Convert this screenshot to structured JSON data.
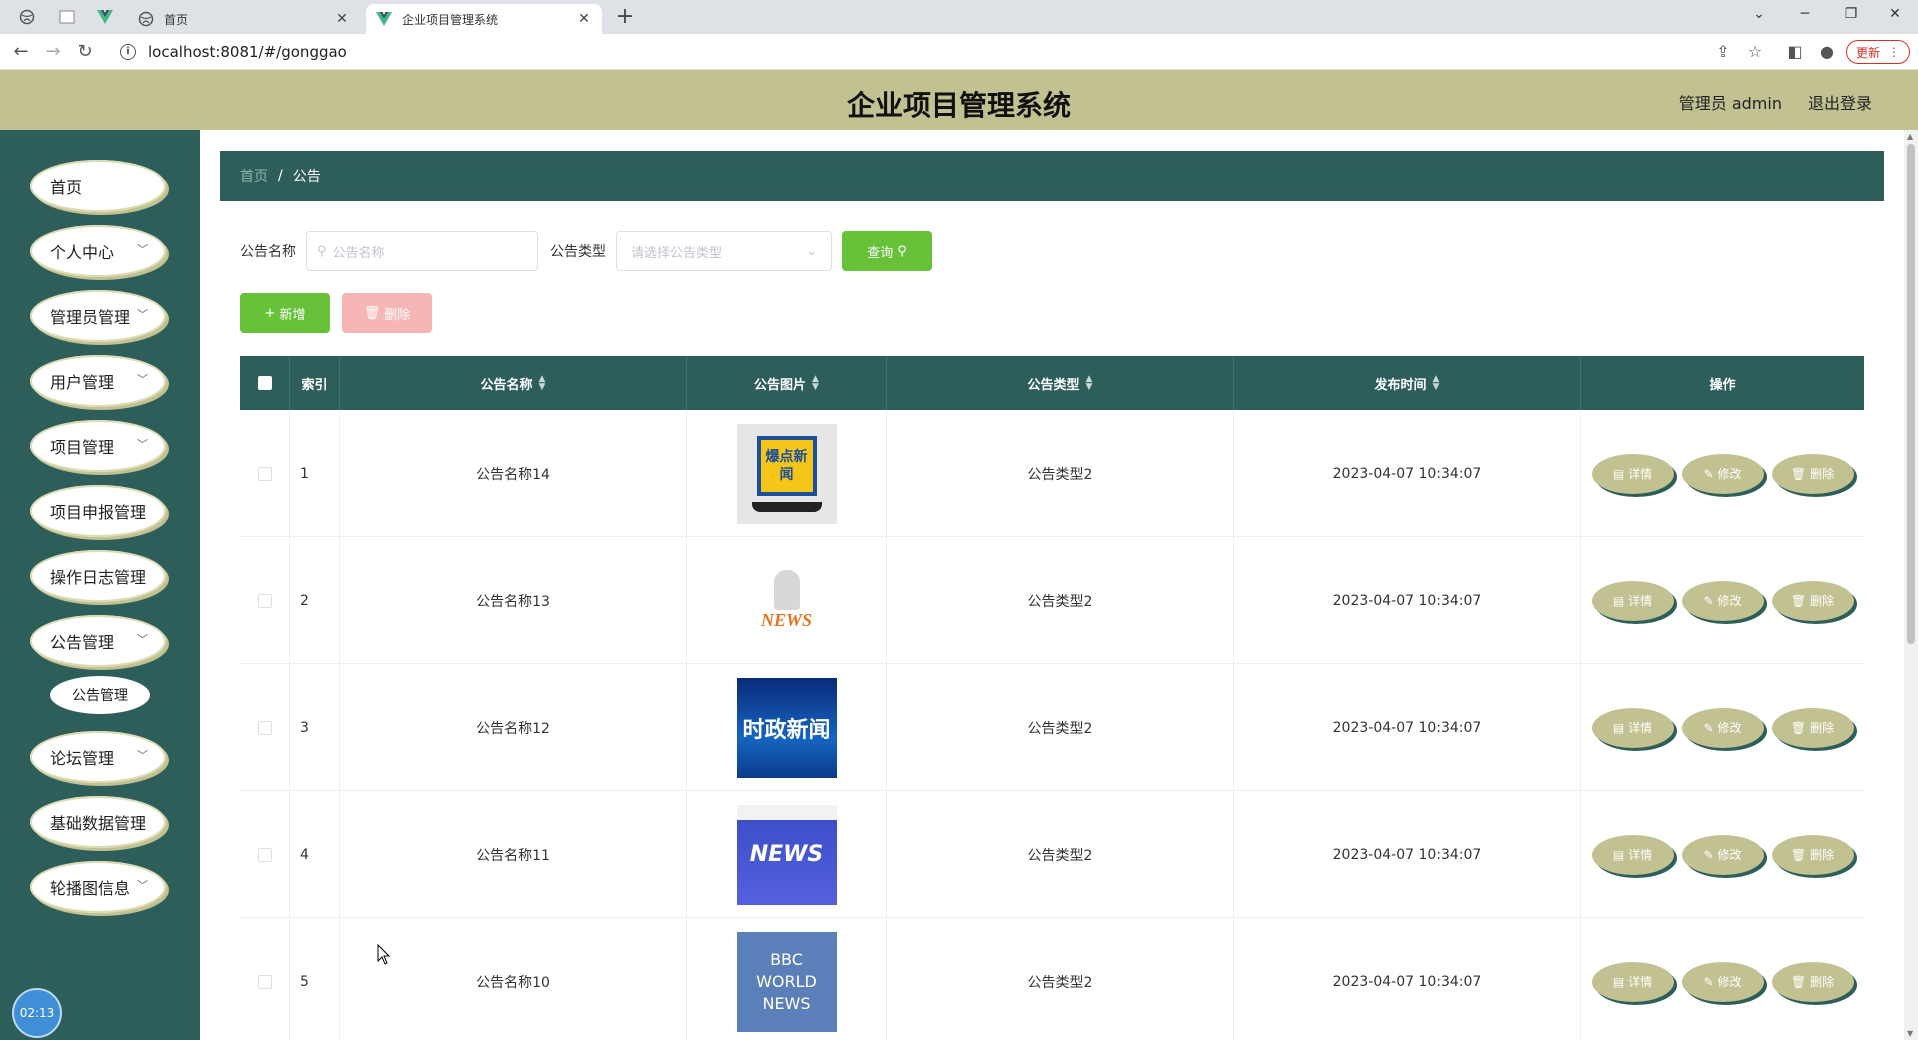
{
  "browser": {
    "tabs": [
      {
        "label": "首页",
        "active": false
      },
      {
        "label": "企业项目管理系统",
        "active": true
      }
    ],
    "url": "localhost:8081/#/gonggao",
    "update_label": "更新"
  },
  "header": {
    "title": "企业项目管理系统",
    "user_label": "管理员 admin",
    "logout_label": "退出登录"
  },
  "sidebar": {
    "items": [
      {
        "label": "首页",
        "has_children": false
      },
      {
        "label": "个人中心",
        "has_children": true
      },
      {
        "label": "管理员管理",
        "has_children": true
      },
      {
        "label": "用户管理",
        "has_children": true
      },
      {
        "label": "项目管理",
        "has_children": true
      },
      {
        "label": "项目申报管理",
        "has_children": false
      },
      {
        "label": "操作日志管理",
        "has_children": false
      },
      {
        "label": "公告管理",
        "has_children": true
      },
      {
        "label": "论坛管理",
        "has_children": true
      },
      {
        "label": "基础数据管理",
        "has_children": false
      },
      {
        "label": "轮播图信息",
        "has_children": true
      }
    ],
    "submenu_label": "公告管理",
    "clock": "02:13"
  },
  "breadcrumb": {
    "home": "首页",
    "separator": "/",
    "current": "公告"
  },
  "search": {
    "name_label": "公告名称",
    "name_placeholder": "公告名称",
    "type_label": "公告类型",
    "type_placeholder": "请选择公告类型",
    "query_label": "查询"
  },
  "actions": {
    "add_label": "新增",
    "delete_label": "删除"
  },
  "table": {
    "columns": [
      "索引",
      "公告名称",
      "公告图片",
      "公告类型",
      "发布时间",
      "操作"
    ],
    "rows": [
      {
        "index": "1",
        "name": "公告名称14",
        "image": "爆点新闻",
        "type": "公告类型2",
        "time": "2023-04-07 10:34:07"
      },
      {
        "index": "2",
        "name": "公告名称13",
        "image": "NEWS",
        "type": "公告类型2",
        "time": "2023-04-07 10:34:07"
      },
      {
        "index": "3",
        "name": "公告名称12",
        "image": "时政新闻",
        "type": "公告类型2",
        "time": "2023-04-07 10:34:07"
      },
      {
        "index": "4",
        "name": "公告名称11",
        "image": "NEWS",
        "type": "公告类型2",
        "time": "2023-04-07 10:34:07"
      },
      {
        "index": "5",
        "name": "公告名称10",
        "image": "BBC WORLD NEWS",
        "type": "公告类型2",
        "time": "2023-04-07 10:34:07"
      }
    ],
    "row_ops": {
      "detail": "详情",
      "edit": "修改",
      "delete": "删除"
    }
  },
  "colors": {
    "header_bg": "#c2c191",
    "sidebar_bg": "#2d5e5a",
    "primary_green": "#67c23a",
    "danger_light": "#f6b6b6"
  }
}
